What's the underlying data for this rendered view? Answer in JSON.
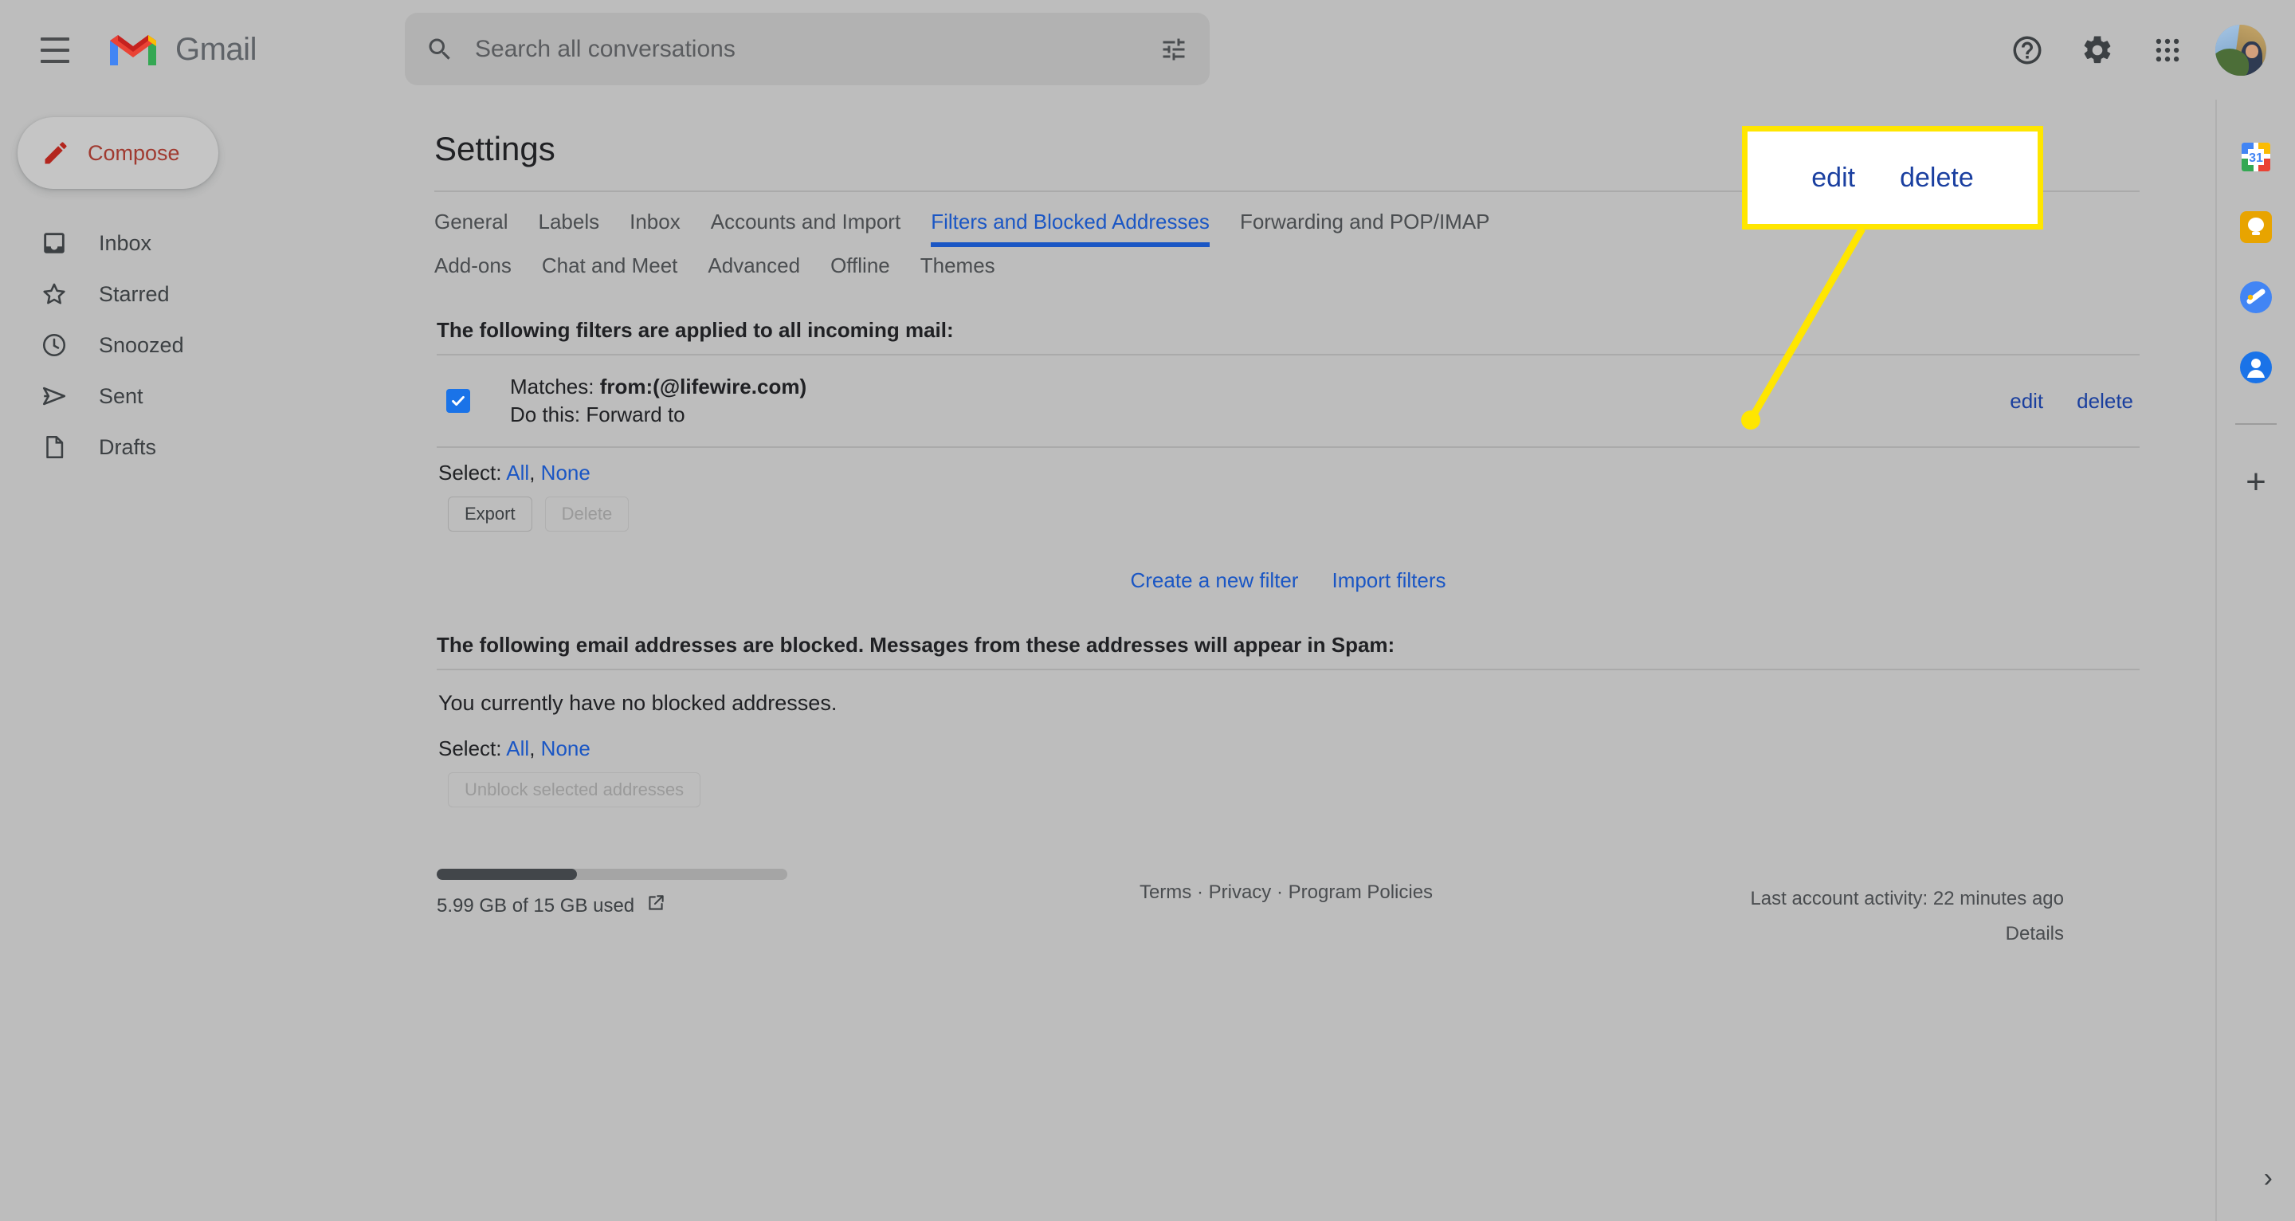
{
  "header": {
    "menu_icon": "hamburger-icon",
    "brand": "Gmail",
    "search": {
      "placeholder": "Search all conversations",
      "value": "",
      "search_icon": "search-icon",
      "options_icon": "tune-icon"
    },
    "help_icon": "help-icon",
    "settings_icon": "gear-icon",
    "apps_icon": "apps-grid-icon",
    "avatar": "account-avatar"
  },
  "sidebar": {
    "compose": {
      "label": "Compose",
      "icon": "pencil-icon"
    },
    "items": [
      {
        "label": "Inbox",
        "icon": "inbox-icon"
      },
      {
        "label": "Starred",
        "icon": "star-icon"
      },
      {
        "label": "Snoozed",
        "icon": "clock-icon"
      },
      {
        "label": "Sent",
        "icon": "send-icon"
      },
      {
        "label": "Drafts",
        "icon": "document-icon"
      }
    ]
  },
  "main": {
    "title": "Settings",
    "tabs_row1": [
      {
        "label": "General",
        "active": false
      },
      {
        "label": "Labels",
        "active": false
      },
      {
        "label": "Inbox",
        "active": false
      },
      {
        "label": "Accounts and Import",
        "active": false
      },
      {
        "label": "Filters and Blocked Addresses",
        "active": true
      },
      {
        "label": "Forwarding and POP/IMAP",
        "active": false
      }
    ],
    "tabs_row2": [
      {
        "label": "Add-ons",
        "active": false
      },
      {
        "label": "Chat and Meet",
        "active": false
      },
      {
        "label": "Advanced",
        "active": false
      },
      {
        "label": "Offline",
        "active": false
      },
      {
        "label": "Themes",
        "active": false
      }
    ],
    "filters_section": {
      "heading": "The following filters are applied to all incoming mail:",
      "rows": [
        {
          "checked": true,
          "matches_label": "Matches:",
          "matches_value": "from:(@lifewire.com)",
          "action_label": "Do this: Forward to",
          "action_value": "",
          "edit_label": "edit",
          "delete_label": "delete"
        }
      ],
      "select_prefix": "Select:",
      "select_all": "All",
      "select_sep": ",",
      "select_none": "None",
      "export_label": "Export",
      "delete_label": "Delete",
      "create_filter_label": "Create a new filter",
      "import_filters_label": "Import filters"
    },
    "blocked_section": {
      "heading": "The following email addresses are blocked. Messages from these addresses will appear in Spam:",
      "empty_text": "You currently have no blocked addresses.",
      "select_prefix": "Select:",
      "select_all": "All",
      "select_sep": ",",
      "select_none": "None",
      "unblock_label": "Unblock selected addresses"
    }
  },
  "footer": {
    "storage_used_text": "5.99 GB of 15 GB used",
    "storage_percent": 40,
    "open_icon": "open-in-new-icon",
    "links": {
      "terms": "Terms",
      "sep1": "·",
      "privacy": "Privacy",
      "sep2": "·",
      "program_policies": "Program Policies"
    },
    "activity": "Last account activity: 22 minutes ago",
    "details": "Details"
  },
  "sidepanel": {
    "items": [
      {
        "name": "google-calendar-icon",
        "label": "31"
      },
      {
        "name": "google-keep-icon",
        "label": ""
      },
      {
        "name": "google-tasks-icon",
        "label": ""
      },
      {
        "name": "google-contacts-icon",
        "label": ""
      }
    ],
    "add_label": "+",
    "expand_label": "›"
  },
  "annotation": {
    "border_color": "#ffe600",
    "line_color": "#ffe600",
    "text_color": "#1a3fa0",
    "edit_label": "edit",
    "delete_label": "delete"
  }
}
